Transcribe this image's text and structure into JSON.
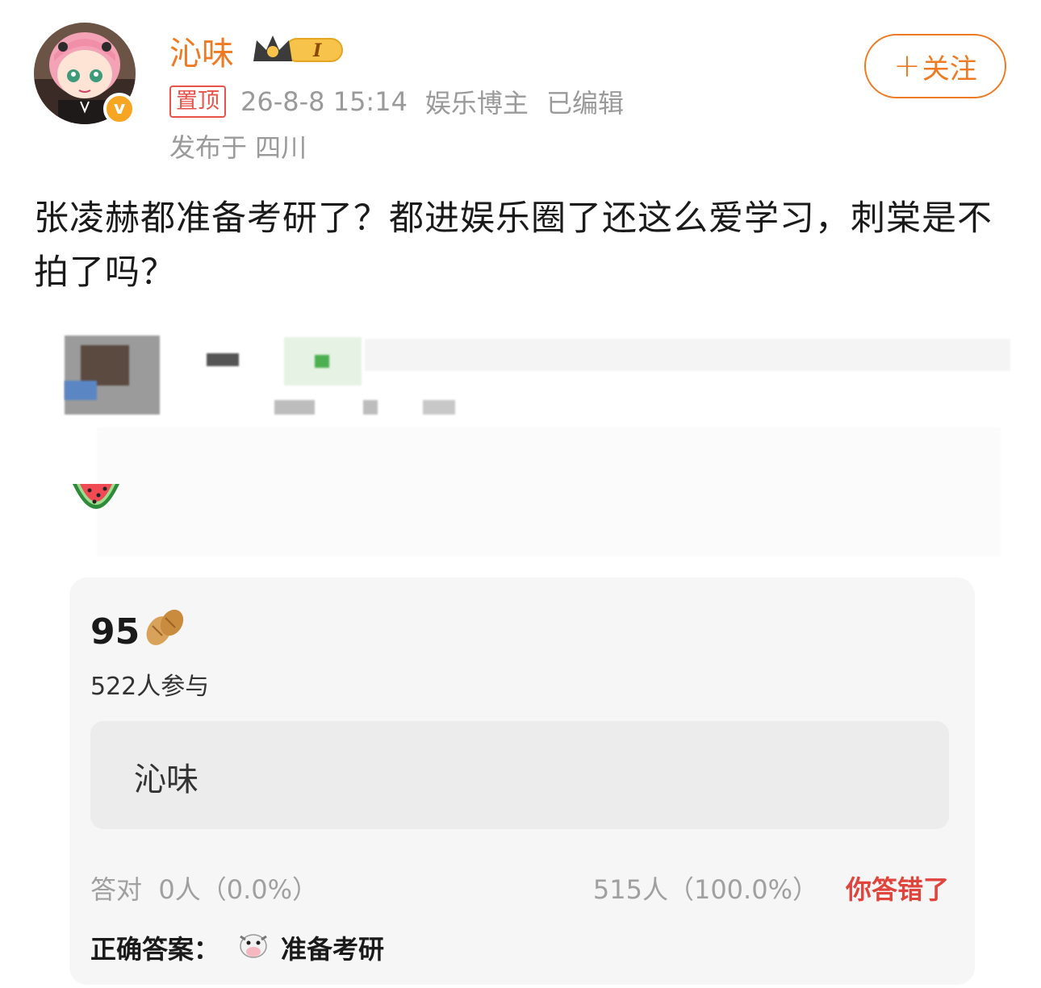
{
  "post": {
    "author": "沁味",
    "level_badge": "I",
    "pin_label": "置顶",
    "timestamp": "26-8-8 15:14",
    "author_role": "娱乐博主",
    "edited_label": "已编辑",
    "location": "发布于 四川",
    "follow_label": "关注",
    "text": "张凌赫都准备考研了？都进娱乐圈了还这么爱学习，刺棠是不拍了吗？"
  },
  "quiz": {
    "score": "95",
    "participants": "522人参与",
    "option": "沁味",
    "correct_stats": "答对  0人（0.0%）",
    "wrong_stats": "515人（100.0%）",
    "wrong_label": "你答错了",
    "answer_prefix": "正确答案：",
    "answer": "准备考研"
  },
  "colors": {
    "accent": "#f07a22",
    "wrong": "#e0443c",
    "card_bg": "#f6f6f6"
  }
}
